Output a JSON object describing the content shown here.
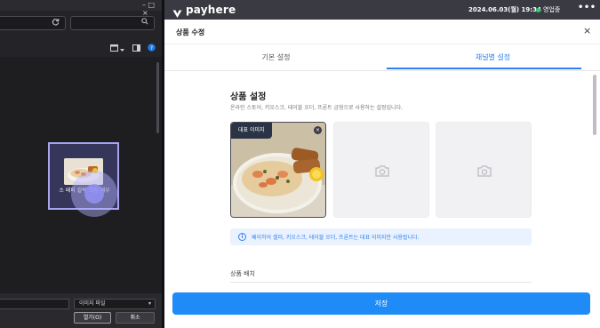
{
  "dialog": {
    "window_controls": "– □ ×",
    "refresh_icon": "refresh-icon",
    "search_icon": "search-icon",
    "file_name": "소 페퍼 갈릭 크림 새우",
    "file_type": "이미지 파일",
    "open_label": "열기(O)",
    "cancel_label": "취소",
    "colors": {
      "selection": "#a7a4f0",
      "background": "#242428"
    }
  },
  "app": {
    "brand": "payhere",
    "datetime": "2024.06.03(월) 19:34",
    "status": "영업중",
    "more_icon": "•••",
    "modal_title": "상품 수정",
    "close_icon": "×",
    "tabs": [
      {
        "label": "기본 설정",
        "active": false
      },
      {
        "label": "채널별 설정",
        "active": true
      }
    ],
    "section": {
      "title": "상품 설정",
      "description": "온라인 스토어, 키오스크, 테이블 오더, 프론트 금형으로 사용하는 설정입니다."
    },
    "images": {
      "badge": "대표 이미지",
      "remove_icon": "×",
      "placeholder_icon": "camera-icon"
    },
    "info": {
      "icon": "i",
      "text": "페이히어 셀러, 키오스크, 테이블 오더, 프론트는 대표 이미지만 사용됩니다."
    },
    "sub_label": "상품 배치",
    "save_label": "저장",
    "colors": {
      "accent": "#2f80ed",
      "save": "#1e8bf7",
      "topbar": "#3a3a42",
      "online": "#2ecc71"
    }
  }
}
